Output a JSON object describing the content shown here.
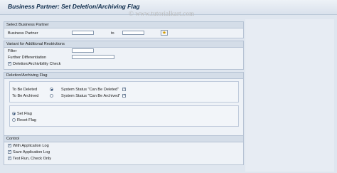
{
  "header": {
    "title": "Business Partner: Set Deletion/Archiving Flag"
  },
  "watermark": "© www.tutorialkart.com",
  "groups": {
    "select_bp": {
      "heading": "Select Business Partner",
      "bp_label": "Business Partner",
      "to_label": "to",
      "from_value": "",
      "to_value": ""
    },
    "variant": {
      "heading": "Variant for Additional Restrictions",
      "filter_label": "Filter",
      "filter_value": "",
      "further_label": "Further Differentiation",
      "further_value": "",
      "check_label": "Deletion/Archivibility Check",
      "check_checked": true
    },
    "flag": {
      "heading": "Deletion/Archiving Flag",
      "deleted_label": "To Be Deleted",
      "deleted_selected": true,
      "deleted_status_label": "System Status \"Can Be Deleted\"",
      "deleted_status_checked": true,
      "archived_label": "To Be Archived",
      "archived_selected": false,
      "archived_status_label": "System Status \"Can Be Archived\"",
      "archived_status_checked": true,
      "set_label": "Set Flag",
      "set_selected": true,
      "reset_label": "Reset Flag",
      "reset_selected": false
    },
    "control": {
      "heading": "Control",
      "with_log_label": "With Application Log",
      "with_log_checked": true,
      "save_log_label": "Save Application Log",
      "save_log_checked": true,
      "test_run_label": "Test Run, Check Only",
      "test_run_checked": true
    }
  }
}
